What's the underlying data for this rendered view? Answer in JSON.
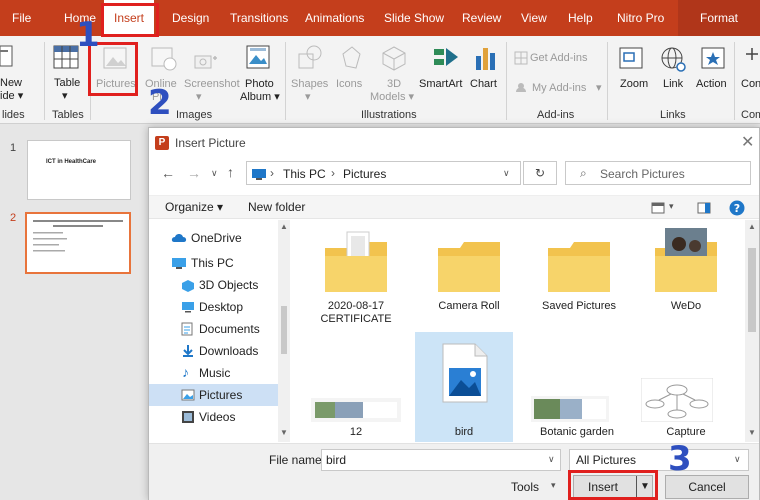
{
  "ribbon_tabs": [
    "File",
    "Home",
    "Insert",
    "Design",
    "Transitions",
    "Animations",
    "Slide Show",
    "Review",
    "View",
    "Help",
    "Nitro Pro",
    "Format"
  ],
  "ribbon": {
    "new_slide_l1": "New",
    "new_slide_l2": "ide ▾",
    "table": "Table",
    "pictures": "Pictures",
    "online_pictures_l1": "Online",
    "online_pictures_l2": "Pi",
    "screenshot": "Screenshot",
    "photo_album_l1": "Photo",
    "photo_album_l2": "Album ▾",
    "shapes": "Shapes",
    "icons": "Icons",
    "models_l1": "3D",
    "models_l2": "Models ▾",
    "smartart": "SmartArt",
    "chart": "Chart",
    "get_addins": "Get Add-ins",
    "my_addins": "My Add-ins",
    "zoom": "Zoom",
    "link": "Link",
    "action": "Action",
    "comment": "Con",
    "groups": {
      "slides": "lides",
      "tables": "Tables",
      "images": "Images",
      "illustrations": "Illustrations",
      "addins": "Add-ins",
      "links": "Links",
      "comments": "Com"
    }
  },
  "slides": {
    "slide1_title": "ICT in HealthCare",
    "slide2_number": "2",
    "slide1_number": "1"
  },
  "dialog": {
    "app_badge": "P",
    "title": "Insert Picture",
    "path": [
      "This PC",
      "Pictures"
    ],
    "search_placeholder": "Search Pictures",
    "organize": "Organize ▾",
    "new_folder": "New folder",
    "nav_items": [
      "OneDrive",
      "This PC",
      "3D Objects",
      "Desktop",
      "Documents",
      "Downloads",
      "Music",
      "Pictures",
      "Videos"
    ],
    "tiles_row1": [
      "2020-08-17 CERTIFICATE",
      "Camera Roll",
      "Saved Pictures",
      "WeDo"
    ],
    "tiles_row2": [
      "12",
      "bird",
      "Botanic garden",
      "Capture"
    ],
    "file_name_label": "File name:",
    "file_name_value": "bird",
    "file_type": "All Pictures",
    "tools": "Tools",
    "insert": "Insert",
    "cancel": "Cancel"
  },
  "annotations": [
    "1",
    "2",
    "3"
  ],
  "colors": {
    "ribbon": "#c43e1c",
    "highlight": "#e0201e",
    "annotation": "#2e4fbf",
    "selected": "#cde0f5"
  }
}
